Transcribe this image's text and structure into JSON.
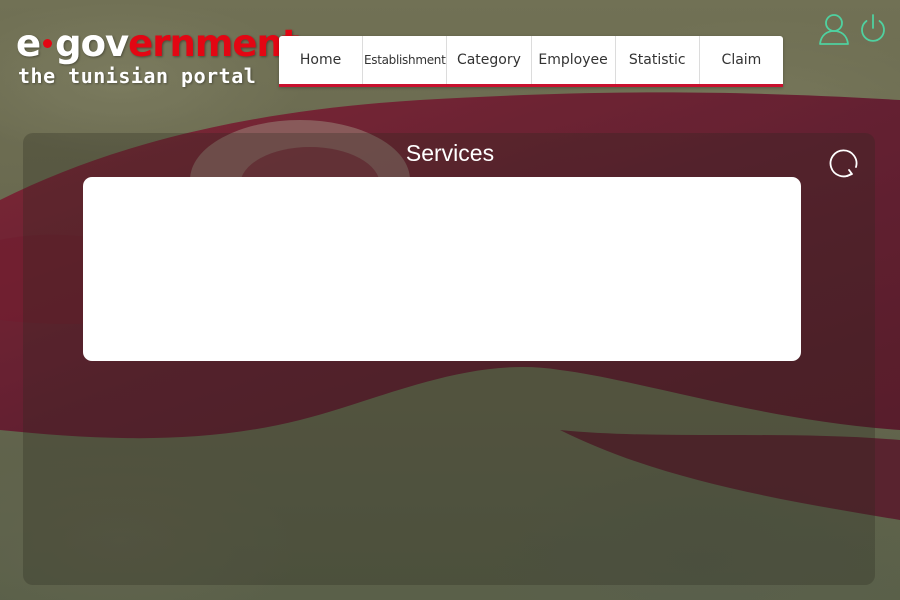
{
  "logo": {
    "part_e": "e",
    "part_gov": "gov",
    "part_ernment": "ernment",
    "tagline": "the tunisian portal"
  },
  "nav": {
    "items": [
      {
        "label": "Home"
      },
      {
        "label": "Establishment"
      },
      {
        "label": "Category"
      },
      {
        "label": "Employee"
      },
      {
        "label": "Statistic"
      },
      {
        "label": "Claim"
      }
    ]
  },
  "header_icons": [
    "user-icon",
    "power-icon"
  ],
  "panel": {
    "title": "Services",
    "refresh_icon": "refresh-icon"
  },
  "colors": {
    "brand_red": "#e30613",
    "nav_underline": "#c8102e",
    "icon_green": "#4fd1a0",
    "panel_box": "#ffffff"
  }
}
